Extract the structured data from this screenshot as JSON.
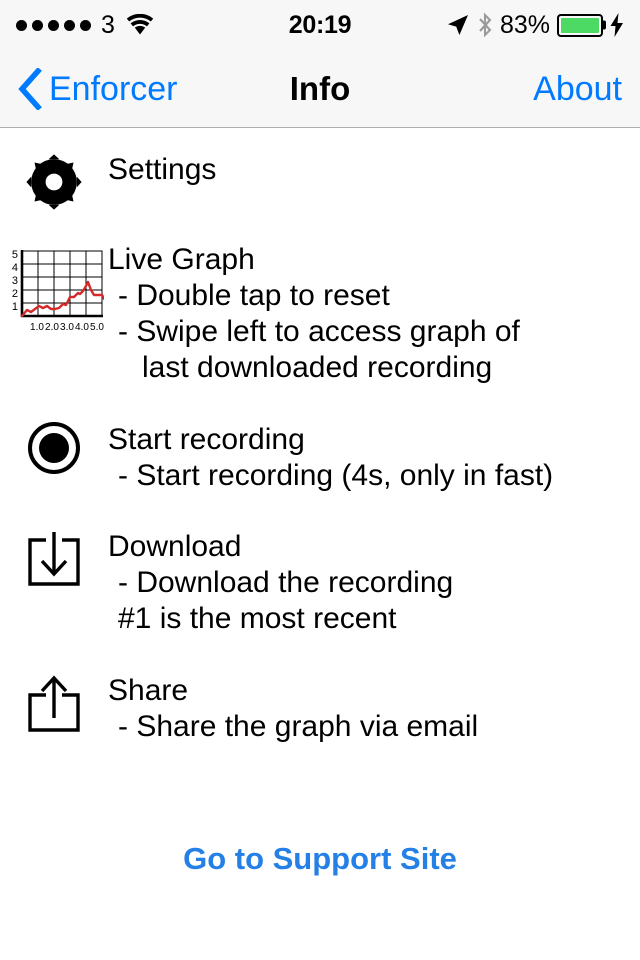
{
  "status_bar": {
    "signal_dots": 5,
    "carrier": "3",
    "wifi_icon": "wifi-icon",
    "time": "20:19",
    "location_icon": "location-arrow-icon",
    "bluetooth_icon": "bluetooth-icon",
    "battery_percent": "83%",
    "battery_level": 83,
    "battery_color": "#4CD964",
    "charging_icon": "lightning-bolt-icon"
  },
  "nav_bar": {
    "back_icon": "chevron-left-icon",
    "back_label": "Enforcer",
    "title": "Info",
    "right_label": "About",
    "tint_color": "#007AFF",
    "background_color": "#F7F7F7"
  },
  "rows": {
    "settings": {
      "icon": "gear-icon",
      "title": "Settings"
    },
    "live_graph": {
      "icon": "line-chart-icon",
      "title": "Live Graph",
      "lines": [
        "- Double tap to reset",
        "- Swipe left to access graph of",
        "last downloaded recording"
      ]
    },
    "start_recording": {
      "icon": "record-icon",
      "title": "Start recording",
      "lines": [
        "- Start recording (4s, only in fast)"
      ]
    },
    "download": {
      "icon": "download-icon",
      "title": "Download",
      "lines": [
        "- Download the recording",
        "#1 is the most recent"
      ]
    },
    "share": {
      "icon": "share-icon",
      "title": "Share",
      "lines": [
        "- Share the graph via email"
      ]
    }
  },
  "support": {
    "label": "Go to Support Site",
    "color": "#2480E6"
  },
  "graph_icon_data": {
    "type": "line",
    "y_ticks": [
      "1",
      "2",
      "3",
      "4",
      "5"
    ],
    "x_ticks": [
      "1.0",
      "2.0",
      "3.0",
      "4.0",
      "5.0"
    ],
    "line_color": "#D42A2A",
    "xlim": [
      0,
      5.5
    ],
    "ylim": [
      0,
      5
    ],
    "points": [
      [
        0.0,
        0.0
      ],
      [
        0.3,
        0.45
      ],
      [
        0.55,
        0.3
      ],
      [
        0.8,
        0.55
      ],
      [
        1.05,
        0.75
      ],
      [
        1.3,
        0.6
      ],
      [
        1.55,
        0.8
      ],
      [
        1.8,
        0.55
      ],
      [
        2.05,
        0.55
      ],
      [
        2.3,
        0.6
      ],
      [
        2.55,
        0.95
      ],
      [
        2.75,
        0.9
      ],
      [
        2.95,
        1.45
      ],
      [
        3.2,
        1.5
      ],
      [
        3.45,
        1.75
      ],
      [
        3.6,
        1.7
      ],
      [
        3.8,
        1.95
      ],
      [
        4.0,
        2.35
      ],
      [
        4.15,
        2.6
      ],
      [
        4.35,
        2.0
      ],
      [
        4.55,
        1.65
      ],
      [
        4.8,
        1.6
      ],
      [
        5.0,
        1.6
      ],
      [
        5.2,
        1.25
      ]
    ]
  }
}
